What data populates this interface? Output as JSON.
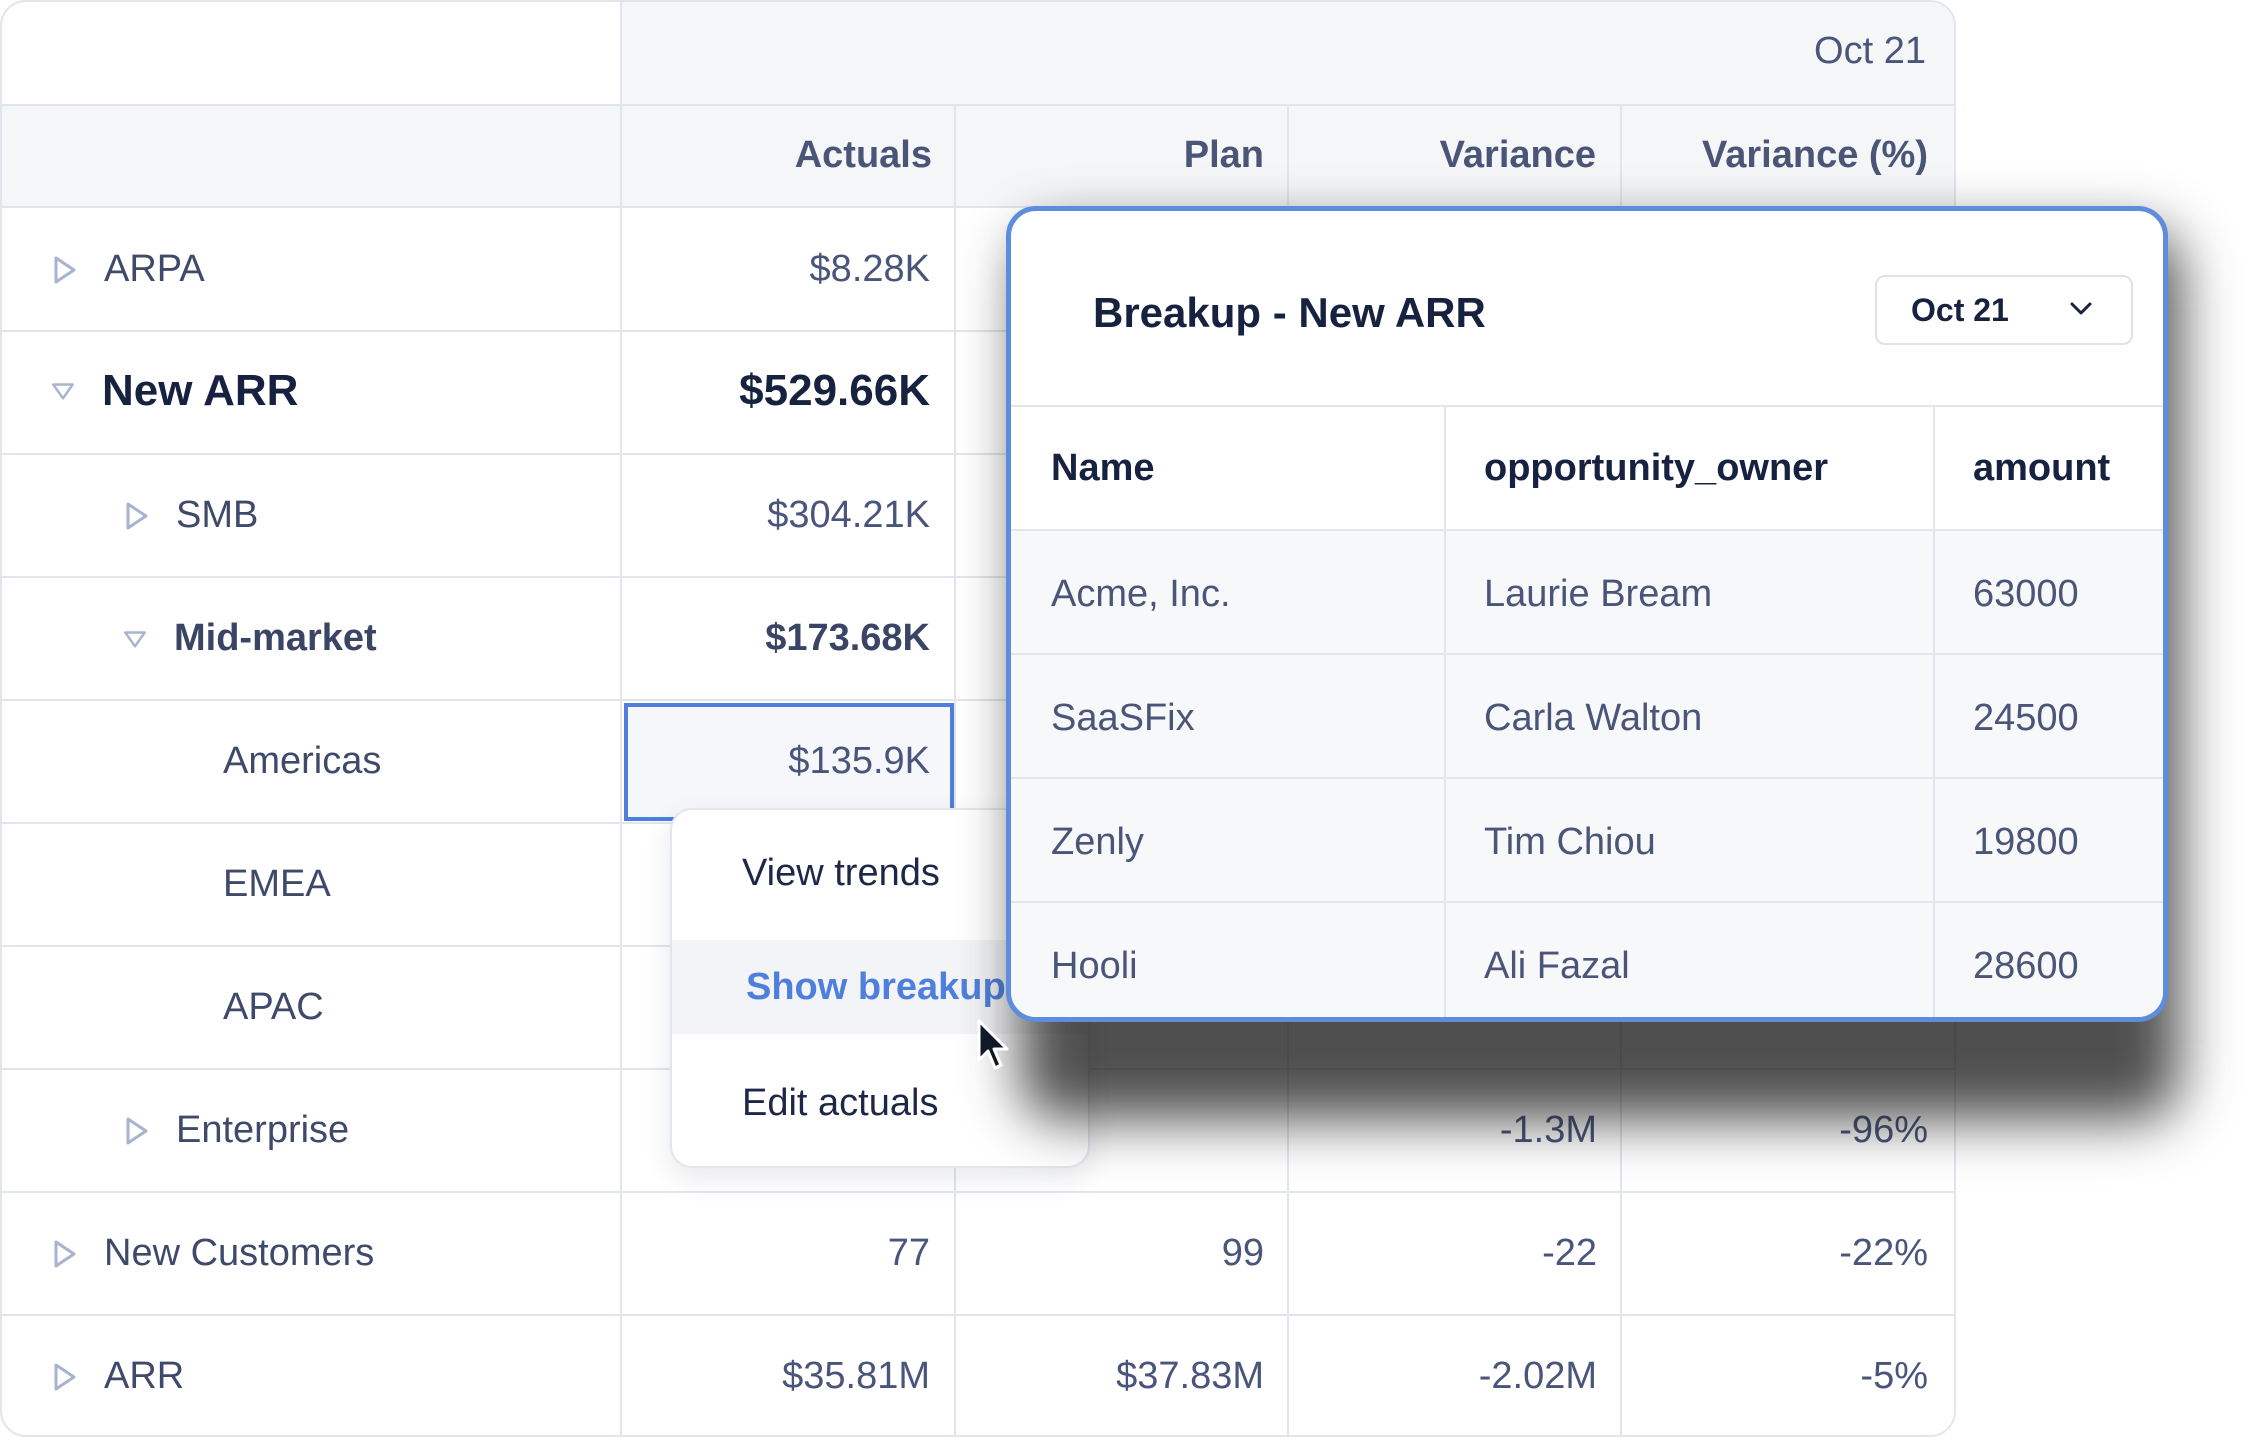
{
  "grid": {
    "period": "Oct 21",
    "columns": [
      "Actuals",
      "Plan",
      "Variance",
      "Variance (%)"
    ],
    "rows": [
      {
        "label": "ARPA",
        "actuals": "$8.28K",
        "plan": "",
        "variance": "",
        "variance_pct": ""
      },
      {
        "label": "New ARR",
        "actuals": "$529.66K",
        "plan": "",
        "variance": "",
        "variance_pct": ""
      },
      {
        "label": "SMB",
        "actuals": "$304.21K",
        "plan": "",
        "variance": "",
        "variance_pct": ""
      },
      {
        "label": "Mid-market",
        "actuals": "$173.68K",
        "plan": "",
        "variance": "",
        "variance_pct": ""
      },
      {
        "label": "Americas",
        "actuals": "$135.9K",
        "plan": "",
        "variance": "",
        "variance_pct": ""
      },
      {
        "label": "EMEA",
        "actuals": "",
        "plan": "",
        "variance": "",
        "variance_pct": ""
      },
      {
        "label": "APAC",
        "actuals": "",
        "plan": "",
        "variance": "",
        "variance_pct": ""
      },
      {
        "label": "Enterprise",
        "actuals": "",
        "plan": "",
        "variance": "-1.3M",
        "variance_pct": "-96%"
      },
      {
        "label": "New Customers",
        "actuals": "77",
        "plan": "99",
        "variance": "-22",
        "variance_pct": "-22%"
      },
      {
        "label": "ARR",
        "actuals": "$35.81M",
        "plan": "$37.83M",
        "variance": "-2.02M",
        "variance_pct": "-5%"
      }
    ]
  },
  "context_menu": {
    "items": [
      "View trends",
      "Show breakup",
      "Edit actuals"
    ],
    "active": "Show breakup"
  },
  "breakup": {
    "title": "Breakup - New ARR",
    "period_select": "Oct 21",
    "columns": [
      "Name",
      "opportunity_owner",
      "amount"
    ],
    "rows": [
      [
        "Acme, Inc.",
        "Laurie Bream",
        "63000"
      ],
      [
        "SaaSFix",
        "Carla Walton",
        "24500"
      ],
      [
        "Zenly",
        "Tim Chiou",
        "19800"
      ],
      [
        "Hooli",
        "Ali Fazal",
        "28600"
      ]
    ]
  },
  "colors": {
    "accent": "#4f7fdc",
    "popup_border": "#5d8ddd",
    "text_dark": "#172140",
    "text_muted": "#49557a",
    "grid_line": "#e2e5ec",
    "triangle": "#a8b3cf"
  },
  "icons": {
    "collapsed": "triangle-right-icon",
    "expanded": "triangle-down-icon",
    "dropdown": "chevron-down-icon",
    "pointer": "cursor-arrow-icon"
  }
}
